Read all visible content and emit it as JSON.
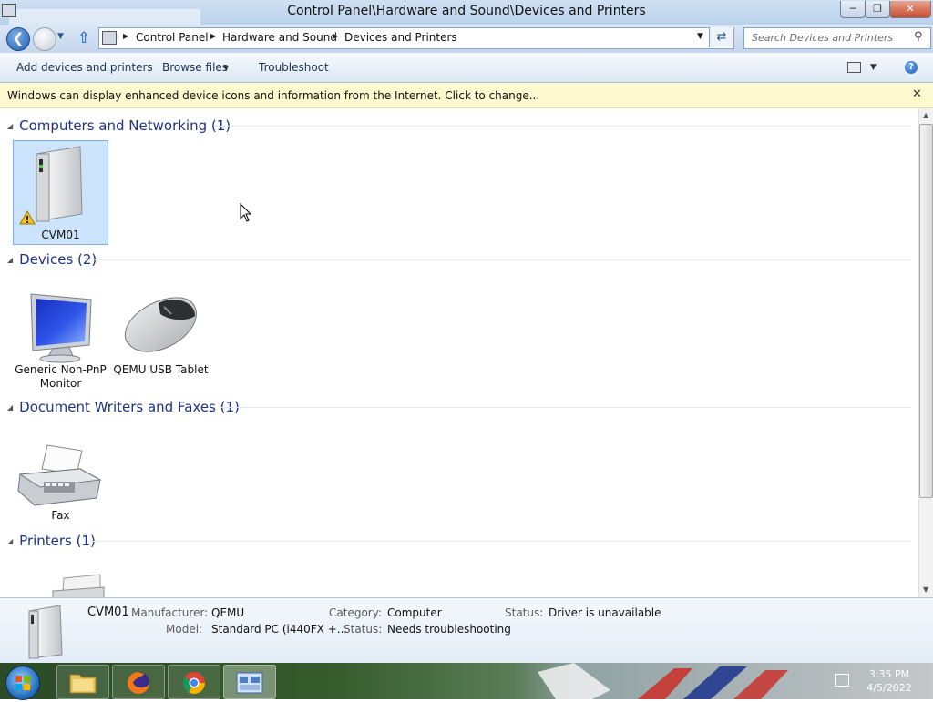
{
  "window": {
    "title": "Control Panel\\Hardware and Sound\\Devices and Printers",
    "minimize": "─",
    "restore": "❐",
    "close": "✕"
  },
  "address": {
    "breadcrumbs": [
      "Control Panel",
      "Hardware and Sound",
      "Devices and Printers"
    ],
    "search_placeholder": "Search Devices and Printers"
  },
  "toolbar": {
    "add_devices": "Add devices and printers",
    "browse_files": "Browse files",
    "troubleshoot": "Troubleshoot"
  },
  "infobar": {
    "text": "Windows can display enhanced device icons and information from the Internet. Click to change..."
  },
  "groups": [
    {
      "title": "Computers and Networking (1)",
      "items": [
        {
          "label": "CVM01",
          "icon": "computer-tower-icon"
        }
      ]
    },
    {
      "title": "Devices (2)",
      "items": [
        {
          "label": "Generic Non-PnP Monitor",
          "icon": "monitor-icon"
        },
        {
          "label": "QEMU USB Tablet",
          "icon": "mouse-icon"
        }
      ]
    },
    {
      "title": "Document Writers and Faxes (1)",
      "items": [
        {
          "label": "Fax",
          "icon": "fax-icon"
        }
      ]
    },
    {
      "title": "Printers (1)",
      "items": [
        {
          "label": "",
          "icon": "printer-icon"
        }
      ]
    }
  ],
  "details": {
    "name": "CVM01",
    "manufacturer_label": "Manufacturer:",
    "manufacturer": "QEMU",
    "model_label": "Model:",
    "model": "Standard PC (i440FX +...",
    "category_label": "Category:",
    "category": "Computer",
    "status_label": "Status:",
    "status1": "Driver is unavailable",
    "status2": "Needs troubleshooting"
  },
  "taskbar": {
    "time": "3:35 PM",
    "date": "4/5/2022",
    "apps": [
      "file-explorer-icon",
      "firefox-icon",
      "chrome-icon",
      "devices-and-printers-icon"
    ]
  },
  "colors": {
    "group_heading": "#1e3287",
    "selection": "#cce4fb",
    "infobar": "#fff9cf"
  }
}
